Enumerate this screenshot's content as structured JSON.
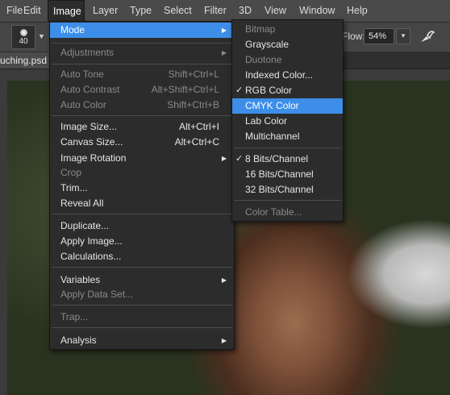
{
  "menubar": {
    "items": [
      "File",
      "Edit",
      "Image",
      "Layer",
      "Type",
      "Select",
      "Filter",
      "3D",
      "View",
      "Window",
      "Help"
    ],
    "active": "Image"
  },
  "options": {
    "brush_size": "40",
    "flow_label": "Flow:",
    "flow_value": "54%"
  },
  "document": {
    "tab_label": "uching.psd"
  },
  "image_menu": {
    "mode": "Mode",
    "adjustments": "Adjustments",
    "auto_tone": "Auto Tone",
    "auto_tone_sc": "Shift+Ctrl+L",
    "auto_contrast": "Auto Contrast",
    "auto_contrast_sc": "Alt+Shift+Ctrl+L",
    "auto_color": "Auto Color",
    "auto_color_sc": "Shift+Ctrl+B",
    "image_size": "Image Size...",
    "image_size_sc": "Alt+Ctrl+I",
    "canvas_size": "Canvas Size...",
    "canvas_size_sc": "Alt+Ctrl+C",
    "image_rotation": "Image Rotation",
    "crop": "Crop",
    "trim": "Trim...",
    "reveal_all": "Reveal All",
    "duplicate": "Duplicate...",
    "apply_image": "Apply Image...",
    "calculations": "Calculations...",
    "variables": "Variables",
    "apply_data_set": "Apply Data Set...",
    "trap": "Trap...",
    "analysis": "Analysis"
  },
  "mode_submenu": {
    "bitmap": "Bitmap",
    "grayscale": "Grayscale",
    "duotone": "Duotone",
    "indexed_color": "Indexed Color...",
    "rgb_color": "RGB Color",
    "cmyk_color": "CMYK Color",
    "lab_color": "Lab Color",
    "multichannel": "Multichannel",
    "bits8": "8 Bits/Channel",
    "bits16": "16 Bits/Channel",
    "bits32": "32 Bits/Channel",
    "color_table": "Color Table...",
    "checkmark": "✓"
  },
  "colors": {
    "highlight": "#3d8ee8",
    "menu_bg": "#2c2c2c",
    "disabled_text": "#8a8a8a"
  }
}
